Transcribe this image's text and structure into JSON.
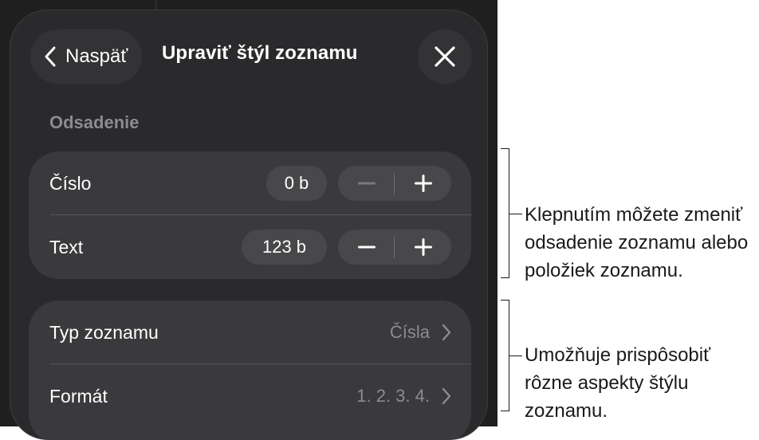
{
  "header": {
    "back_label": "Naspäť",
    "title": "Upraviť štýl zoznamu"
  },
  "indent_section": {
    "header": "Odsadenie",
    "rows": [
      {
        "label": "Číslo",
        "value": "0 b",
        "minus_enabled": false
      },
      {
        "label": "Text",
        "value": "123 b",
        "minus_enabled": true
      }
    ]
  },
  "list_section": {
    "rows": [
      {
        "label": "Typ zoznamu",
        "value": "Čísla"
      },
      {
        "label": "Formát",
        "value": "1. 2. 3. 4."
      }
    ]
  },
  "callouts": [
    "Klepnutím môžete zmeniť odsadenie zoznamu alebo položiek zoznamu.",
    "Umožňuje prispôsobiť rôzne aspekty štýlu zoznamu."
  ],
  "colors": {
    "panel_bg": "#2a2a2c",
    "group_bg": "#3a3a3d",
    "control_bg": "#48484b",
    "secondary_text": "#8c8c8f"
  },
  "icons": [
    "chevron-left-icon",
    "close-icon",
    "minus-icon",
    "plus-icon",
    "chevron-right-icon"
  ]
}
